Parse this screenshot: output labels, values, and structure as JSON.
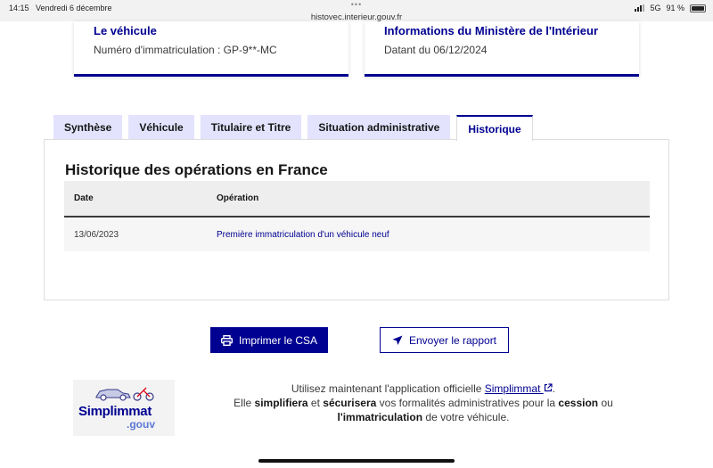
{
  "status_bar": {
    "time": "14:15",
    "date": "Vendredi 6 décembre",
    "url": "histovec.interieur.gouv.fr",
    "network": "5G",
    "battery": "91 %"
  },
  "cards": [
    {
      "title": "Le véhicule",
      "text": "Numéro d'immatriculation : GP-9**-MC"
    },
    {
      "title": "Informations du Ministère de l'Intérieur",
      "text": "Datant du 06/12/2024"
    }
  ],
  "tabs": [
    {
      "label": "Synthèse",
      "active": false
    },
    {
      "label": "Véhicule",
      "active": false
    },
    {
      "label": "Titulaire et Titre",
      "active": false
    },
    {
      "label": "Situation administrative",
      "active": false
    },
    {
      "label": "Historique",
      "active": true
    }
  ],
  "history": {
    "heading": "Historique des opérations en France",
    "columns": [
      "Date",
      "Opération"
    ],
    "rows": [
      {
        "date": "13/06/2023",
        "operation": "Première immatriculation d'un véhicule neuf"
      }
    ]
  },
  "actions": {
    "print_label": "Imprimer le CSA",
    "send_label": "Envoyer le rapport"
  },
  "promo": {
    "logo_name": "Simplimmat",
    "logo_suffix": ".gouv",
    "line1_prefix": "Utilisez maintenant l'application officielle",
    "link": "Simplimmat",
    "line1_suffix": ".",
    "line2_a": "Elle",
    "line2_b": "simplifiera",
    "line2_c": "et",
    "line2_d": "sécurisera",
    "line2_e": "vos formalités administratives pour la",
    "line2_f": "cession",
    "line2_g": "ou",
    "line3_a": "l'immatriculation",
    "line3_b": "de votre véhicule."
  },
  "colors": {
    "primary": "#000091",
    "tab_inactive": "#e3e3fd",
    "table_header": "#eeeeee"
  }
}
